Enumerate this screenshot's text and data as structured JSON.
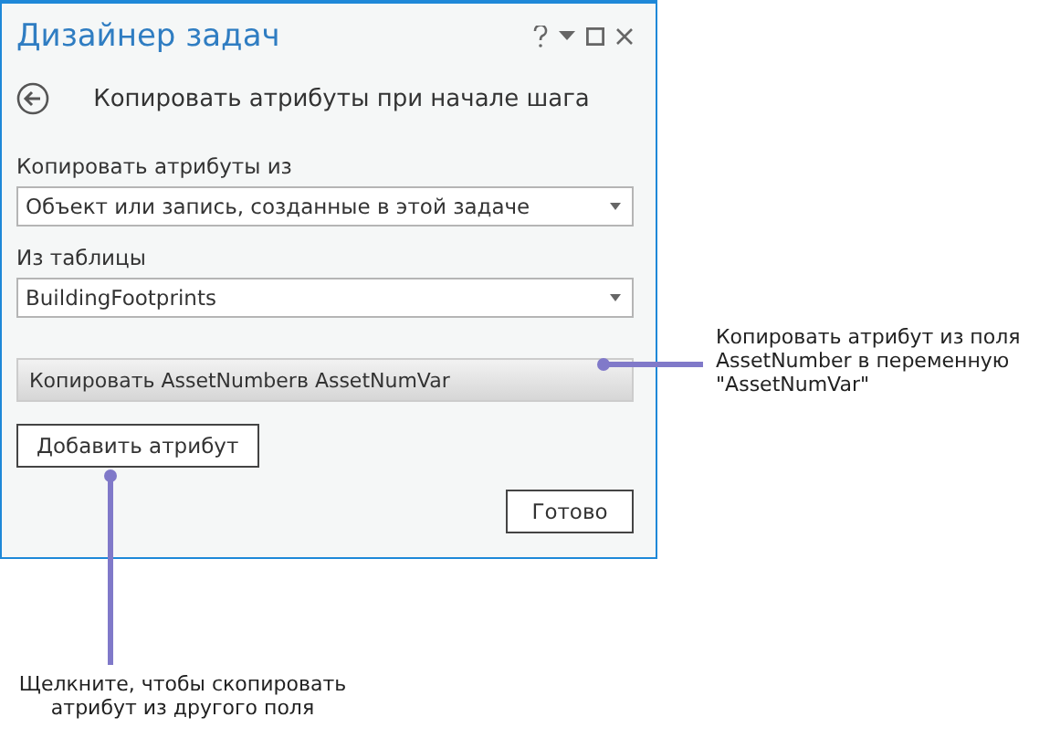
{
  "window": {
    "title": "Дизайнер задач"
  },
  "header": {
    "title": "Копировать атрибуты при начале шага"
  },
  "fields": [
    {
      "label": "Копировать атрибуты из",
      "value": "Объект или запись, созданные в этой задаче"
    },
    {
      "label": "Из таблицы",
      "value": "BuildingFootprints"
    }
  ],
  "copy_rows": [
    "Копировать AssetNumberв AssetNumVar"
  ],
  "add_button": "Добавить атрибут",
  "done_button": "Готово",
  "callouts": [
    {
      "kind": "right",
      "text": "Копировать атрибут из поля AssetNumber в переменную \"AssetNumVar\""
    },
    {
      "kind": "bottom",
      "text": "Щелкните, чтобы скопировать атрибут из другого поля"
    }
  ]
}
